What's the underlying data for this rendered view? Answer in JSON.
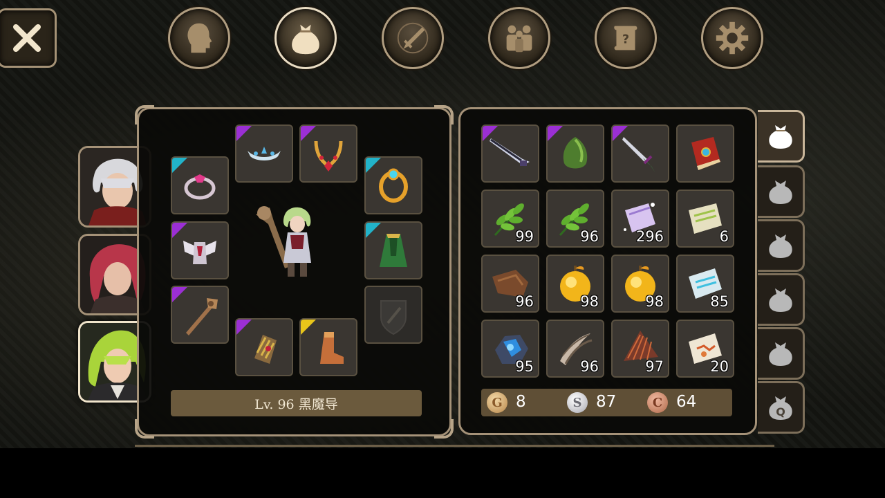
{
  "equipment": {
    "level_label": "Lv. 96 黑魔导"
  },
  "inventory": {
    "items": [
      {
        "icon": "dark-sword-icon",
        "rarity": "purple",
        "count": ""
      },
      {
        "icon": "green-gem-icon",
        "rarity": "purple",
        "count": ""
      },
      {
        "icon": "dagger-icon",
        "rarity": "purple",
        "count": ""
      },
      {
        "icon": "red-book-icon",
        "rarity": "",
        "count": ""
      },
      {
        "icon": "herb-leaf-icon",
        "rarity": "",
        "count": "99"
      },
      {
        "icon": "herb-leaf-icon",
        "rarity": "",
        "count": "96"
      },
      {
        "icon": "magic-scroll-icon",
        "rarity": "",
        "count": "296"
      },
      {
        "icon": "scroll-icon",
        "rarity": "",
        "count": "6"
      },
      {
        "icon": "leather-hide-icon",
        "rarity": "",
        "count": "96"
      },
      {
        "icon": "golden-apple-icon",
        "rarity": "",
        "count": "98"
      },
      {
        "icon": "golden-apple-icon",
        "rarity": "",
        "count": "98"
      },
      {
        "icon": "blue-scroll-icon",
        "rarity": "",
        "count": "85"
      },
      {
        "icon": "blue-ore-icon",
        "rarity": "",
        "count": "95"
      },
      {
        "icon": "claw-icon",
        "rarity": "",
        "count": "96"
      },
      {
        "icon": "feather-fan-icon",
        "rarity": "",
        "count": "97"
      },
      {
        "icon": "map-scroll-icon",
        "rarity": "",
        "count": "20"
      }
    ],
    "currency": {
      "gold": "8",
      "silver": "87",
      "copper": "64",
      "gold_letter": "G",
      "silver_letter": "S",
      "copper_letter": "C"
    }
  },
  "bag_tabs": {
    "last_tab_letter": "Q"
  },
  "colors": {
    "rarity_purple": "#9b2fd4",
    "rarity_cyan": "#22b3c9",
    "rarity_yellow": "#e8c51a",
    "panel_border": "#a59278"
  }
}
